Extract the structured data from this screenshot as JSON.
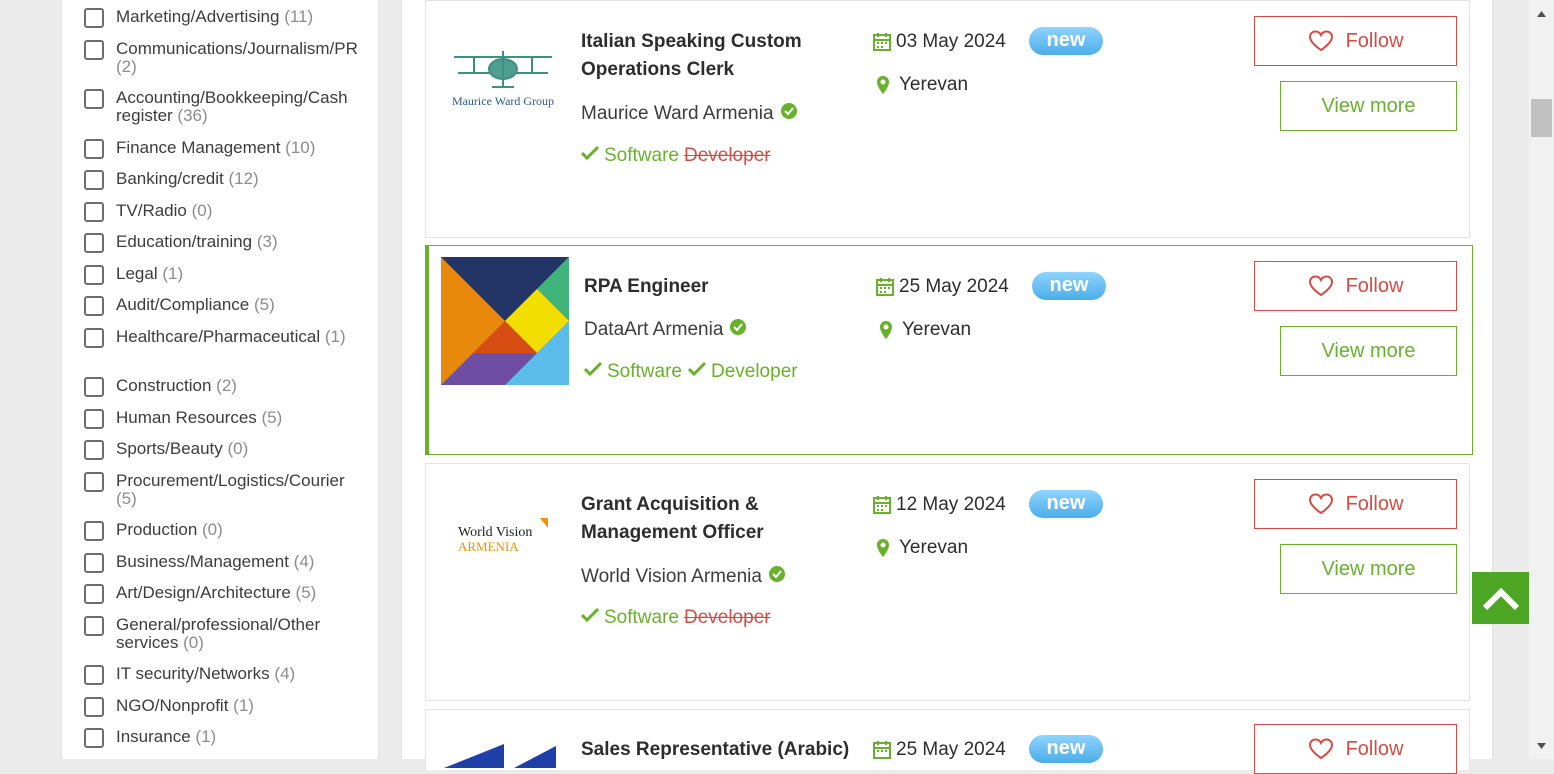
{
  "sidebar": {
    "categories": [
      {
        "label": "Marketing/Advertising",
        "count": "(11)"
      },
      {
        "label": "Communications/Journalism/PR",
        "count": "(2)"
      },
      {
        "label": "Accounting/Bookkeeping/Cash register",
        "count": "(36)"
      },
      {
        "label": "Finance Management",
        "count": "(10)"
      },
      {
        "label": "Banking/credit",
        "count": "(12)"
      },
      {
        "label": "TV/Radio",
        "count": "(0)"
      },
      {
        "label": "Education/training",
        "count": "(3)"
      },
      {
        "label": "Legal",
        "count": "(1)"
      },
      {
        "label": "Audit/Compliance",
        "count": "(5)"
      },
      {
        "label": "Healthcare/Pharmaceutical",
        "count": "(1)"
      },
      {
        "label": "Construction",
        "count": "(2)"
      },
      {
        "label": "Human Resources",
        "count": "(5)"
      },
      {
        "label": "Sports/Beauty",
        "count": "(0)"
      },
      {
        "label": "Procurement/Logistics/Courier",
        "count": "(5)"
      },
      {
        "label": "Production",
        "count": "(0)"
      },
      {
        "label": "Business/Management",
        "count": "(4)"
      },
      {
        "label": "Art/Design/Architecture",
        "count": "(5)"
      },
      {
        "label": "General/professional/Other services",
        "count": "(0)"
      },
      {
        "label": "IT security/Networks",
        "count": "(4)"
      },
      {
        "label": "NGO/Nonprofit",
        "count": "(1)"
      },
      {
        "label": "Insurance",
        "count": "(1)"
      }
    ]
  },
  "jobs": [
    {
      "title": "Italian Speaking Custom Operations Clerk",
      "company": "Maurice Ward Armenia",
      "logo_text": "Maurice Ward Group",
      "tag1": "Software",
      "tag2": "Developer",
      "date": "03 May 2024",
      "badge": "new",
      "location": "Yerevan",
      "follow": "Follow",
      "view_more": "View more"
    },
    {
      "title": "RPA Engineer",
      "company": "DataArt Armenia",
      "tag1": "Software",
      "tag2": "Developer",
      "date": "25 May 2024",
      "badge": "new",
      "location": "Yerevan",
      "follow": "Follow",
      "view_more": "View more"
    },
    {
      "title": "Grant Acquisition & Management Officer",
      "company": "World Vision Armenia",
      "logo_text_1": "World Vision",
      "logo_text_2": "ARMENIA",
      "tag1": "Software",
      "tag2": "Developer",
      "date": "12 May 2024",
      "badge": "new",
      "location": "Yerevan",
      "follow": "Follow",
      "view_more": "View more"
    },
    {
      "title": "Sales Representative (Arabic)",
      "date": "25 May 2024",
      "badge": "new",
      "follow": "Follow"
    }
  ],
  "colors": {
    "accent_green": "#67b22a",
    "follow_red": "#d64b43",
    "badge_blue": "#5bb8f0"
  }
}
